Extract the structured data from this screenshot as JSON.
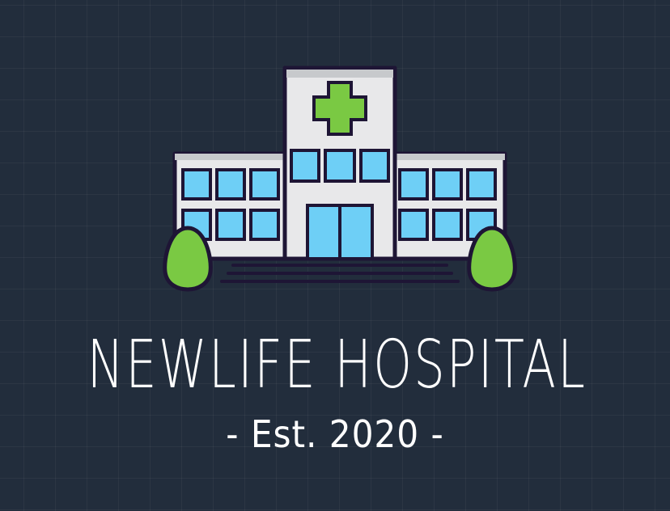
{
  "logo": {
    "title": "NEWLIFE HOSPITAL",
    "subtitle": "- Est. 2020 -",
    "icon": "hospital-building-icon"
  },
  "colors": {
    "background": "#222d3c",
    "building": "#e8e8ea",
    "window": "#6ecff6",
    "cross": "#7ac943",
    "tree": "#7ac943",
    "outline": "#1e1535",
    "text": "#ffffff"
  }
}
